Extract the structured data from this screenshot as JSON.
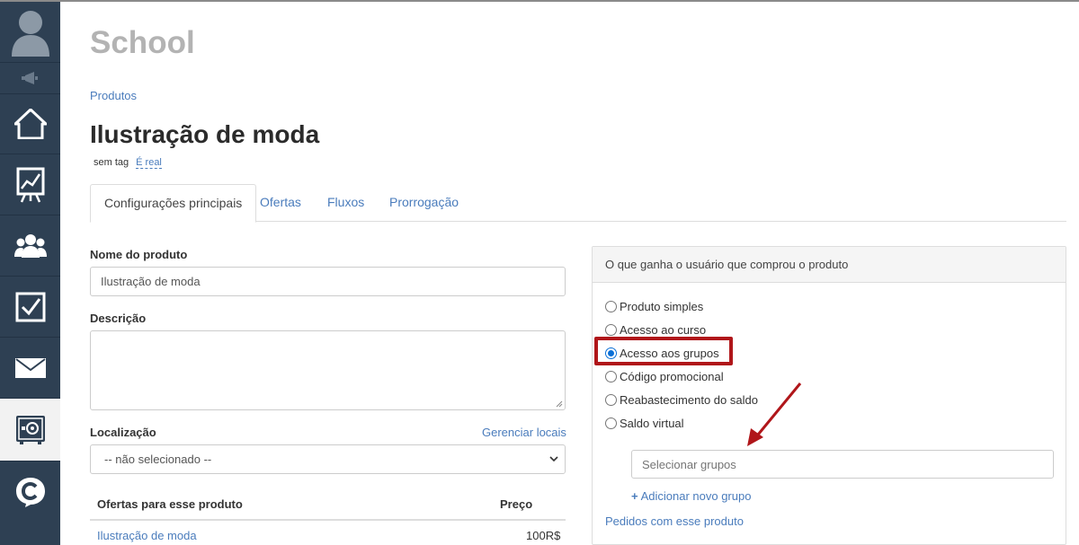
{
  "app": {
    "name": "School"
  },
  "sidebar": {
    "items": [
      {
        "icon": "user-avatar-icon"
      },
      {
        "icon": "megaphone-icon"
      },
      {
        "icon": "home-icon"
      },
      {
        "icon": "chart-board-icon"
      },
      {
        "icon": "users-group-icon"
      },
      {
        "icon": "checkbox-icon"
      },
      {
        "icon": "mail-icon"
      },
      {
        "icon": "safe-icon",
        "active": true
      },
      {
        "icon": "chat-logo-icon"
      }
    ]
  },
  "breadcrumb": "Produtos",
  "product": {
    "title": "Ilustração de moda",
    "tag": "sem tag",
    "real_label": "É real"
  },
  "tabs": [
    {
      "label": "Configurações principais",
      "active": true
    },
    {
      "label": "Ofertas"
    },
    {
      "label": "Fluxos"
    },
    {
      "label": "Prorrogação"
    }
  ],
  "form": {
    "name_label": "Nome do produto",
    "name_value": "Ilustração de moda",
    "description_label": "Descrição",
    "description_value": "",
    "location_label": "Localização",
    "manage_locations": "Gerenciar locais",
    "location_selected": "-- não selecionado --"
  },
  "offers": {
    "header_name": "Ofertas para esse produto",
    "header_price": "Preço",
    "rows": [
      {
        "name": "Ilustração de moda",
        "price": "100R$"
      }
    ]
  },
  "panel": {
    "title": "O que ganha o usuário que comprou o produto",
    "options": [
      {
        "label": "Produto simples",
        "checked": false
      },
      {
        "label": "Acesso ao curso",
        "checked": false
      },
      {
        "label": "Acesso aos grupos",
        "checked": true
      },
      {
        "label": "Código promocional",
        "checked": false
      },
      {
        "label": "Reabastecimento do saldo",
        "checked": false
      },
      {
        "label": "Saldo virtual",
        "checked": false
      }
    ],
    "groups_placeholder": "Selecionar grupos",
    "add_group": "Adicionar novo grupo",
    "orders_link": "Pedidos com esse produto"
  },
  "colors": {
    "sidebar": "#2e4053",
    "link": "#4a7cbc",
    "highlight": "#b0161a",
    "radio_checked": "#0a6fd6"
  }
}
